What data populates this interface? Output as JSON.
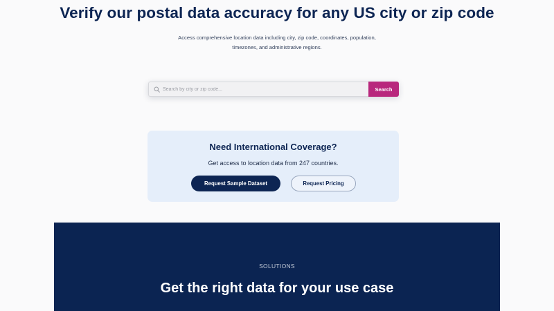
{
  "hero": {
    "title": "Verify our postal data accuracy for any US city or zip code",
    "subtitle_line1": "Access comprehensive location data including city, zip code, coordinates, population,",
    "subtitle_line2": "timezones, and administrative regions."
  },
  "search": {
    "placeholder": "Search by city or zip code...",
    "value": "",
    "button_label": "Search",
    "icon": "search-icon"
  },
  "international": {
    "title": "Need International Coverage?",
    "subtitle": "Get access to location data from 247 countries.",
    "primary_button": "Request Sample Dataset",
    "secondary_button": "Request Pricing"
  },
  "solutions": {
    "eyebrow": "SOLUTIONS",
    "title": "Get the right data for your use case"
  },
  "colors": {
    "navy": "#0d2553",
    "accent_magenta": "#b8287d",
    "card_background": "#e5eefa",
    "page_background": "#fafafb"
  }
}
